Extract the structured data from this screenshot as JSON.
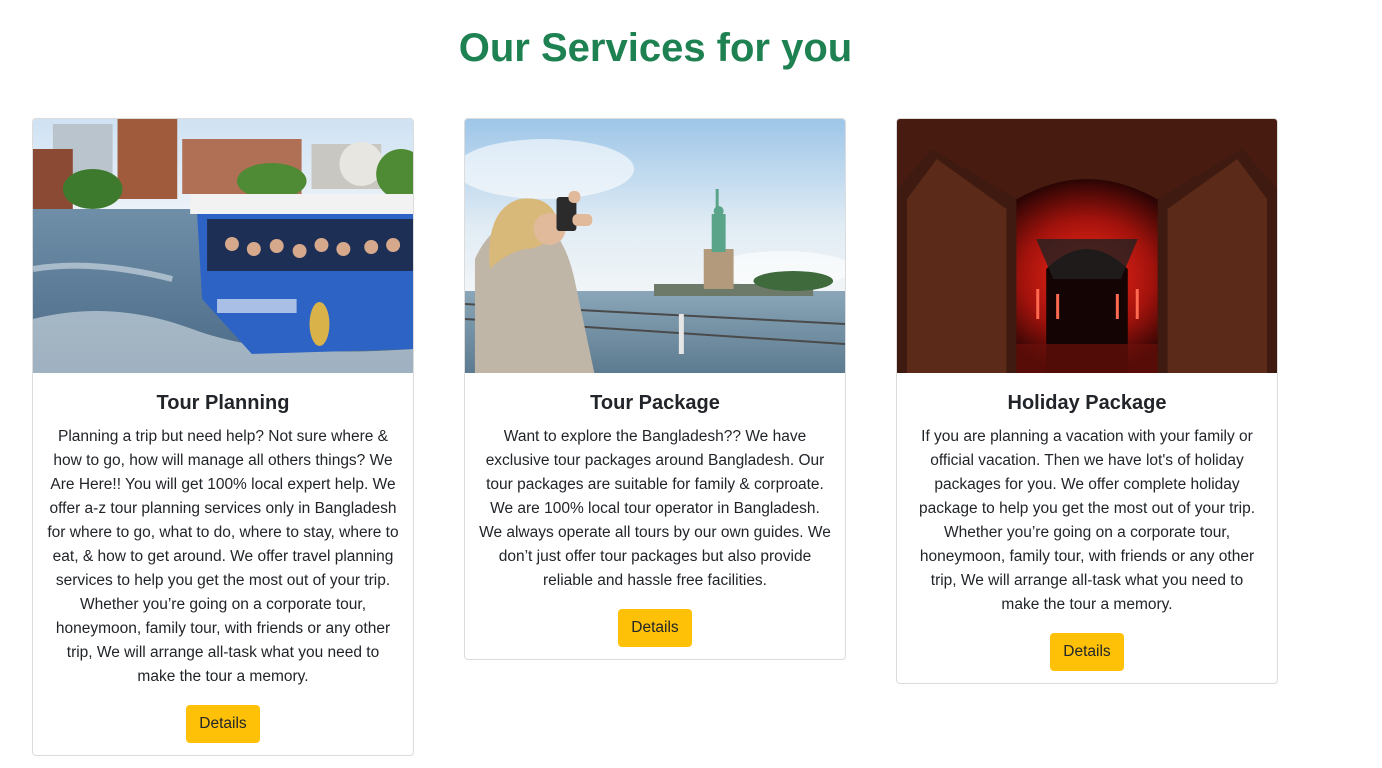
{
  "section": {
    "title": "Our Services for you"
  },
  "services": [
    {
      "title": "Tour Planning",
      "description": "Planning a trip but need help? Not sure where & how to go, how will manage all others things? We Are Here!! You will get 100% local expert help. We offer a-z tour planning services only in Bangladesh for where to go, what to do, where to stay, where to eat, & how to get around. We offer travel planning services to help you get the most out of your trip. Whether you’re going on a corporate tour, honeymoon, family tour, with friends or any other trip, We will arrange all-task what you need to make the tour a memory.",
      "button_label": "Details",
      "image": "boston-duck-tour-boat-photo"
    },
    {
      "title": "Tour Package",
      "description": "Want to explore the Bangladesh?? We have exclusive tour packages around Bangladesh. Our tour packages are suitable for family & corproate. We are 100% local tour operator in Bangladesh. We always operate all tours by our own guides. We don’t just offer tour packages but also provide reliable and hassle free facilities.",
      "button_label": "Details",
      "image": "statue-of-liberty-photo"
    },
    {
      "title": "Holiday Package",
      "description": "If you are planning a vacation with your family or official vacation. Then we have lot's of holiday packages for you. We offer complete holiday package to help you get the most out of your trip. Whether you’re going on a corporate tour, honeymoon, family tour, with friends or any other trip, We will arrange all-task what you need to make the tour a memory.",
      "button_label": "Details",
      "image": "red-lit-tunnel-doorway-photo"
    }
  ],
  "colors": {
    "title": "#1e8152",
    "button": "#ffc107",
    "card_border": "#dcdcdc"
  }
}
